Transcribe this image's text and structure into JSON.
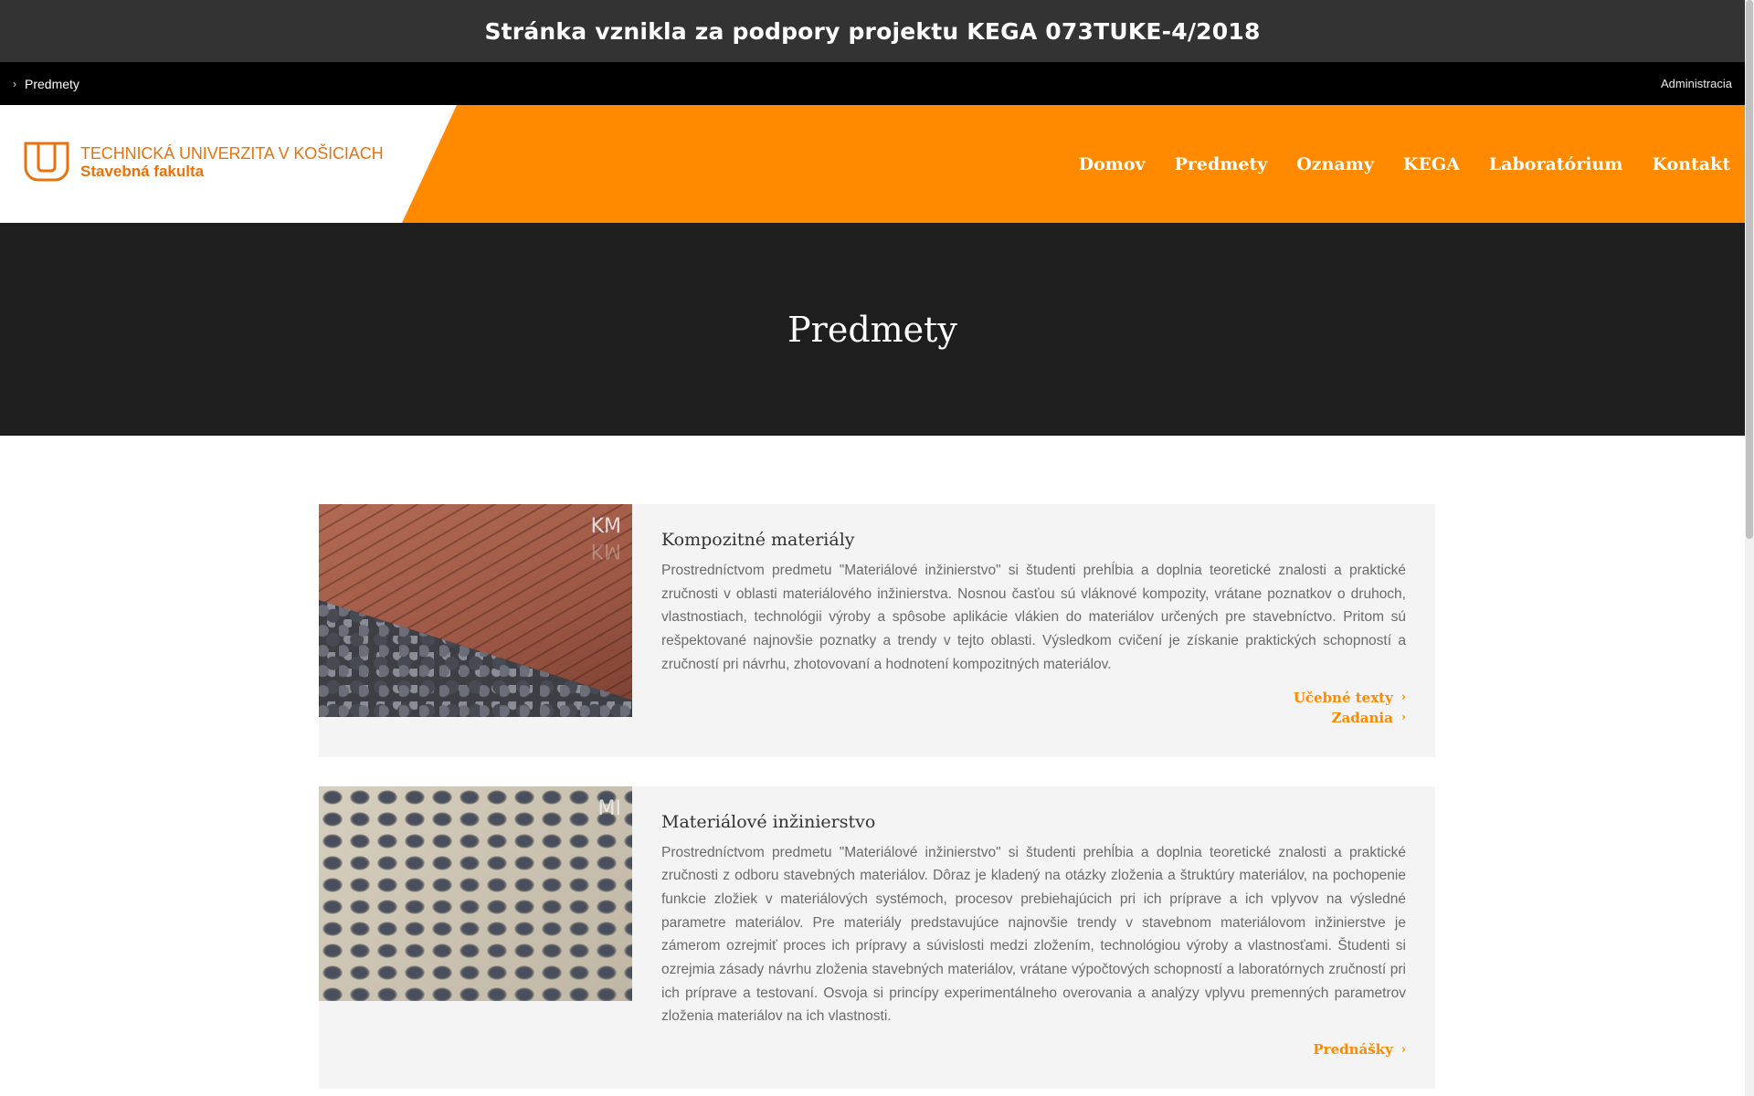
{
  "banner": {
    "text": "Stránka vznikla za podpory projektu KEGA 073TUKE-4/2018"
  },
  "topbar": {
    "breadcrumb": "Predmety",
    "admin": "Administracia"
  },
  "logo": {
    "university": "TECHNICKÁ UNIVERZITA V KOŠICIACH",
    "faculty": "Stavebná fakulta"
  },
  "nav": {
    "items": [
      "Domov",
      "Predmety",
      "Oznamy",
      "KEGA",
      "Laboratórium",
      "Kontakt"
    ]
  },
  "hero": {
    "title": "Predmety"
  },
  "courses": [
    {
      "code": "KM",
      "title": "Kompozitné materiály",
      "description": "Prostredníctvom predmetu \"Materiálové inžinierstvo\" si študenti prehĺbia a doplnia teoretické znalosti a praktické zručnosti v oblasti materiálového inžinierstva. Nosnou časťou sú vláknové kompozity, vrátane poznatkov o druhoch, vlastnostiach, technológii výroby a spôsobe aplikácie vlákien do materiálov určených pre stavebníctvo. Pritom sú rešpektované najnovšie poznatky a trendy v tejto oblasti. Výsledkom cvičení je získanie praktických schopností a zručností pri návrhu, zhotovovaní a hodnotení kompozitných materiálov.",
      "links": [
        "Učebné texty",
        "Zadania"
      ]
    },
    {
      "code": "MI",
      "title": "Materiálové inžinierstvo",
      "description": "Prostredníctvom predmetu \"Materiálové inžinierstvo\" si študenti prehĺbia a doplnia teoretické znalosti a praktické zručnosti z odboru stavebných materiálov. Dôraz je kladený na otázky zloženia a štruktúry materiálov, na pochopenie funkcie zložiek v materiálových systémoch, procesov prebiehajúcich pri ich príprave a ich vplyvov na výsledné parametre materiálov. Pre materiály predstavujúce najnovšie trendy v stavebnom materiálovom inžinierstve je zámerom ozrejmiť proces ich prípravy a súvislosti medzi zložením, technológiou výroby a vlastnosťami. Študenti si ozrejmia zásady návrhu zloženia stavebných materiálov, vrátane výpočtových schopností a laboratórnych zručností pri ich príprave a testovaní. Osvoja si princípy experimentálneho overovania a analýzy vplyvu premenných parametrov zloženia materiálov na ich vlastnosti.",
      "links": [
        "Prednášky"
      ]
    }
  ],
  "icons": {
    "breadcrumb": "chevron-right-icon",
    "link": "chevron-right-icon",
    "logo": "tuke-logo-icon"
  },
  "colors": {
    "accent": "#ff8a00",
    "banner": "#333333",
    "topbar": "#000000",
    "hero": "#1e1e1e",
    "card": "#f4f4f4"
  }
}
